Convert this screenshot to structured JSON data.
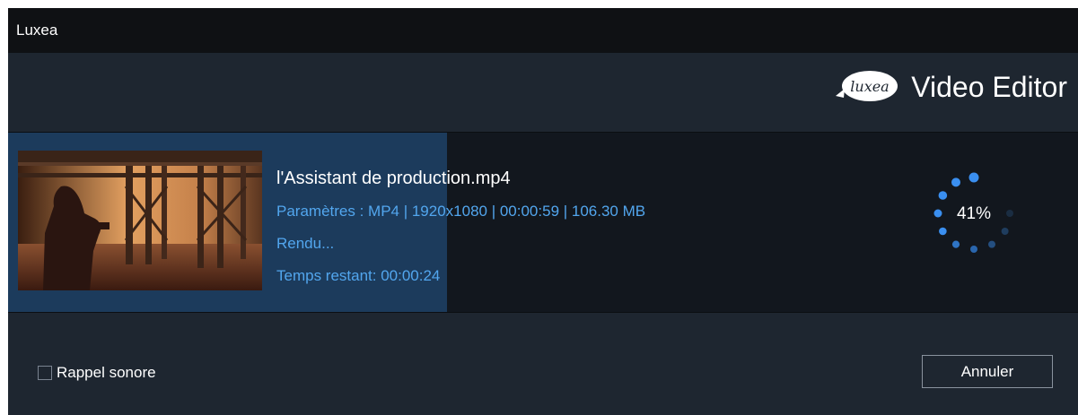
{
  "window": {
    "title": "Luxea"
  },
  "header": {
    "logo_text": "luxea",
    "product_name": "Video Editor"
  },
  "export": {
    "file_name": "l'Assistant de production.mp4",
    "params": "Paramètres : MP4 | 1920x1080 | 00:00:59 | 106.30 MB",
    "status": "Rendu...",
    "time_remaining": "Temps restant: 00:00:24",
    "progress_percent": 41,
    "progress_label": "41%"
  },
  "footer": {
    "sound_reminder_label": "Rappel sonore",
    "sound_reminder_checked": false,
    "cancel_label": "Annuler"
  },
  "colors": {
    "accent": "#3a8ff0",
    "meta_text": "#52a6ee",
    "progress_fill": "#1c3b5c",
    "panel_bg": "#12171e",
    "window_bg": "#1e2630",
    "titlebar_bg": "#0f1114"
  }
}
